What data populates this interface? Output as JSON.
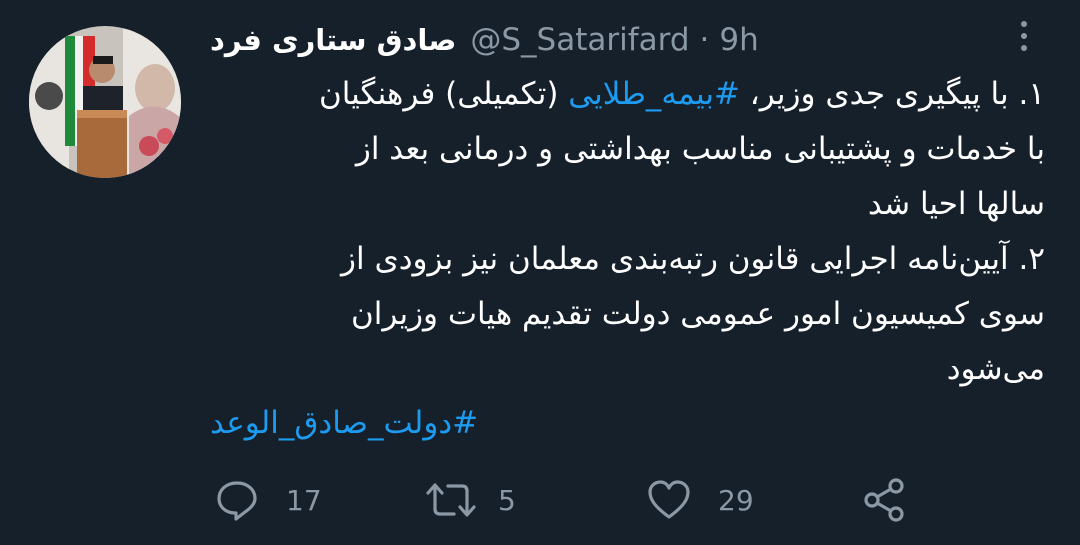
{
  "tweet": {
    "author_name": "صادق ستاری فرد",
    "handle": "@S_Satarifard",
    "separator": "·",
    "time": "9h",
    "lines": [
      {
        "before": "۱. با پیگیری جدی وزیر، ",
        "hashtag": "#بیمه_طلایی",
        "after": " (تکمیلی) فرهنگیان"
      },
      {
        "text": "با خدمات و پشتیبانی مناسب بهداشتی و درمانی بعد از"
      },
      {
        "text": "سالها احیا شد"
      },
      {
        "text": "۲. آیین‌نامه اجرایی قانون رتبه‌بندی معلمان نیز بزودی از"
      },
      {
        "text": "سوی کمیسیون امور عمومی دولت تقدیم هیات وزیران"
      },
      {
        "text": "می‌شود"
      }
    ],
    "footer_hashtag": "#دولت_صادق_الوعد"
  },
  "actions": {
    "reply": {
      "icon": "reply-icon",
      "count": "17"
    },
    "retweet": {
      "icon": "retweet-icon",
      "count": "5"
    },
    "like": {
      "icon": "heart-icon",
      "count": "29"
    },
    "share": {
      "icon": "share-icon"
    }
  },
  "colors": {
    "background": "#15202b",
    "text": "#ffffff",
    "muted": "#8b98a5",
    "link": "#1d9bf0"
  }
}
